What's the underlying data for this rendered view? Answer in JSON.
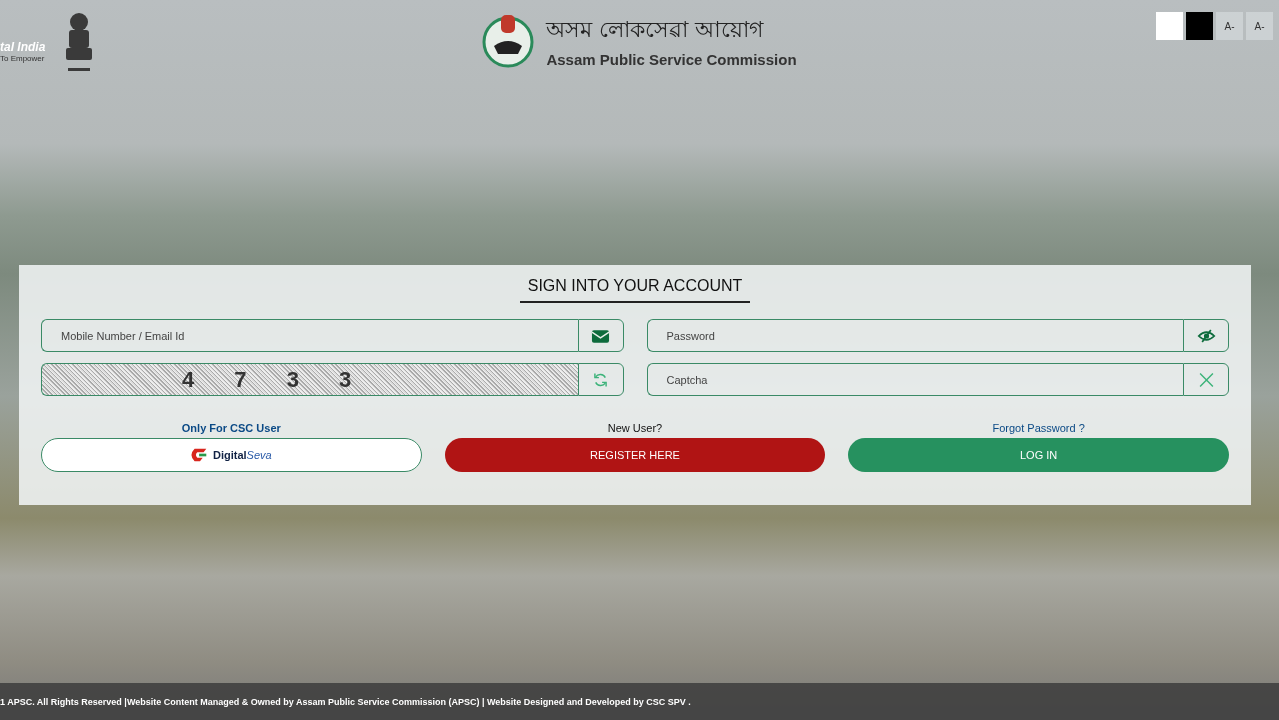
{
  "header": {
    "partner_text": "tal India",
    "partner_tagline": "To Empower",
    "org_name_local": "অসম লোকসেৱা আয়োগ",
    "org_name": "Assam Public Service Commission",
    "display_controls": [
      {
        "kind": "swatch",
        "color": "#ffffff"
      },
      {
        "kind": "swatch",
        "color": "#000000"
      },
      {
        "kind": "text",
        "label": "A-"
      },
      {
        "kind": "text",
        "label": "A-"
      }
    ]
  },
  "login": {
    "title": "SIGN INTO YOUR ACCOUNT",
    "fields": [
      {
        "kind": "input",
        "placeholder": "Mobile Number / Email Id"
      },
      {
        "kind": "input",
        "placeholder": "Password"
      },
      {
        "kind": "captcha",
        "code": "4 7 3 3"
      },
      {
        "kind": "input",
        "placeholder": "Captcha"
      }
    ],
    "actions": [
      {
        "caption": "Only For CSC User",
        "kind": "csc",
        "label_parts": [
          "Digital",
          "Seva"
        ]
      },
      {
        "caption": "New User?",
        "kind": "register",
        "label": "REGISTER HERE"
      },
      {
        "caption": "Forgot Password ?",
        "kind": "login",
        "label": "LOG IN"
      }
    ]
  },
  "footer": {
    "text": "1 APSC. All Rights Reserved |Website Content Managed & Owned by Assam Public Service Commission (APSC) | Website Designed and Developed by CSC SPV ."
  }
}
